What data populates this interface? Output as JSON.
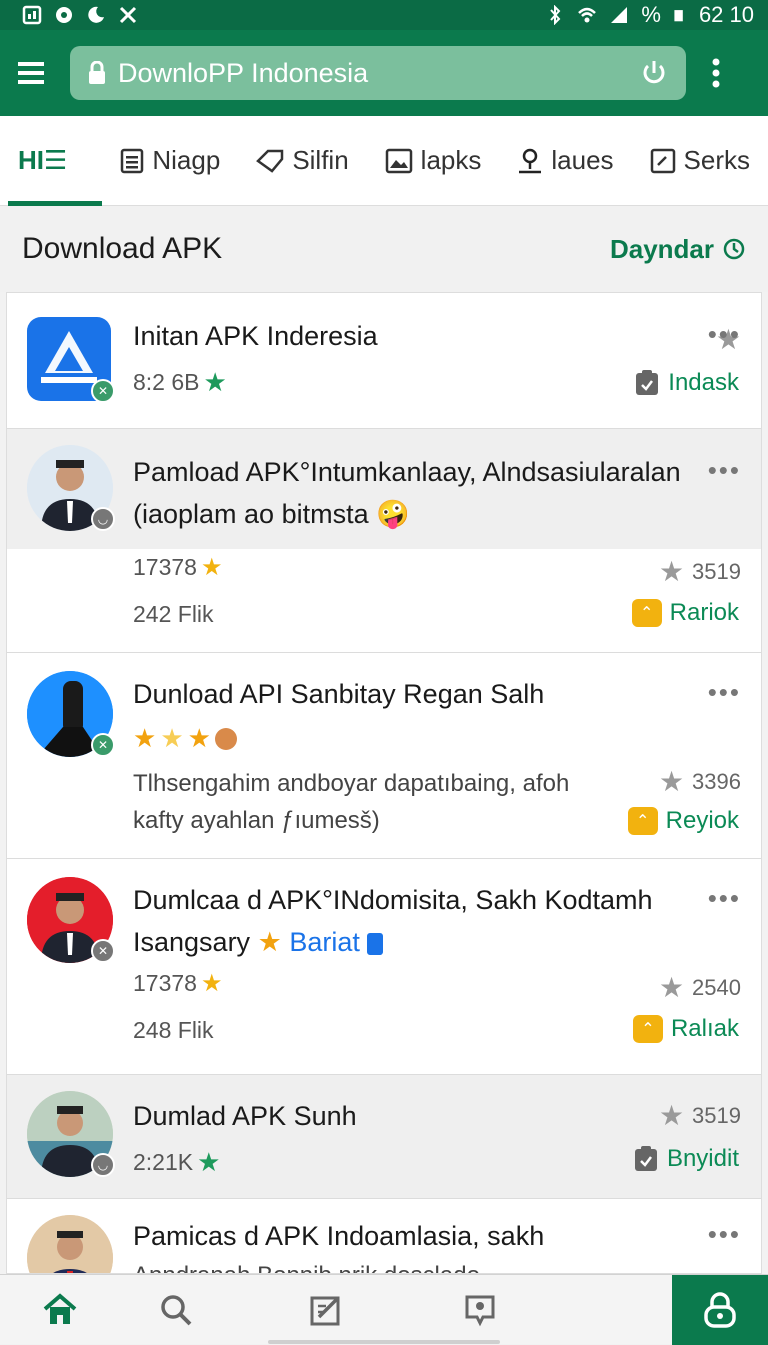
{
  "status_bar": {
    "time": "62 10",
    "battery_pct": "%"
  },
  "browser": {
    "url": "DownloPP Indonesia"
  },
  "tabs": [
    {
      "label": "HI☰",
      "icon": "grid-icon",
      "active": true
    },
    {
      "label": "Niagp",
      "icon": "list-icon",
      "active": false
    },
    {
      "label": "Silfin",
      "icon": "tag-icon",
      "active": false
    },
    {
      "label": "lapks",
      "icon": "image-icon",
      "active": false
    },
    {
      "label": "laues",
      "icon": "pin-icon",
      "active": false
    },
    {
      "label": "Serks",
      "icon": "edit-icon",
      "active": false
    }
  ],
  "section": {
    "title": "Download APK",
    "action": "Dayndar"
  },
  "cards": [
    {
      "title": "Initan APK Inderesia",
      "meta": "8:2 6B",
      "action": "Indask",
      "action_icon": "clipboard-icon"
    },
    {
      "title": "Pamload APK°Intumkanlaay, Alndsasiularalan (iaoplam ao bitmsta",
      "meta1": "17378",
      "meta2": "242 Flik",
      "rating": "3519",
      "action": "Rariok",
      "action_icon": "crown-icon"
    },
    {
      "title": "Dunload API Sanbitay Regan Salh",
      "desc": "Tlhsengahim andboyar dapatıbaing, afoh kafty ayahlan ƒıumesš)",
      "rating": "3396",
      "action": "Reyiok",
      "action_icon": "crown-icon"
    },
    {
      "title": "Dumlcaa d APK°INdomisita, Sakh Kodtamh Isangsary",
      "tag": "Bariat",
      "meta1": "17378",
      "meta2": "248 Flik",
      "rating": "2540",
      "action": "Ralıak",
      "action_icon": "crown-icon"
    },
    {
      "title": "Dumlad APK Sunh",
      "meta": "2:21K",
      "rating": "3519",
      "action": "Bnyidit",
      "action_icon": "clipboard-icon"
    },
    {
      "title": "Pamicas d APK Indoamlasia, sakh",
      "desc": "Anndranah Bonnib nrik dosclado"
    }
  ],
  "bottom_nav": [
    {
      "name": "home",
      "icon": "home-icon",
      "active": true
    },
    {
      "name": "search",
      "icon": "search-icon"
    },
    {
      "name": "edit",
      "icon": "edit-icon"
    },
    {
      "name": "chat",
      "icon": "chat-icon"
    },
    {
      "name": "lock",
      "icon": "lock-icon"
    }
  ],
  "colors": {
    "primary": "#0b7a4d",
    "status_bar": "#0b6b45",
    "star_green": "#1e9a5c",
    "star_gold": "#f2b20f",
    "grey_star": "#9a9a9a"
  }
}
